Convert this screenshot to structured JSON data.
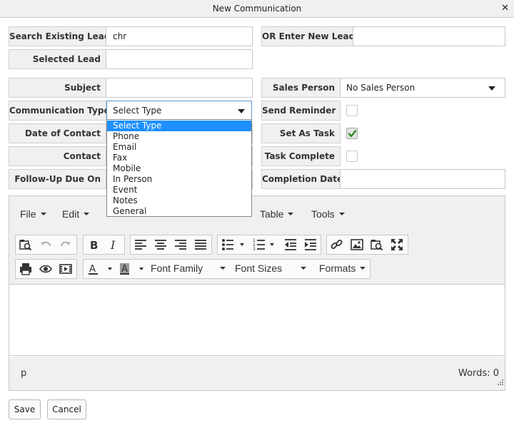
{
  "dialog": {
    "title": "New Communication"
  },
  "lead": {
    "search_label": "Search Existing Lead",
    "search_value": "chr",
    "new_label": "OR  Enter New Lead",
    "new_value": "",
    "selected_label": "Selected Lead",
    "selected_value": ""
  },
  "form": {
    "subject_label": "Subject",
    "subject_value": "",
    "comm_type_label": "Communication Type",
    "comm_type_value": "Select Type",
    "date_label": "Date of Contact",
    "contact_label": "Contact",
    "followup_label": "Follow-Up Due On",
    "sales_person_label": "Sales Person",
    "sales_person_value": "No Sales Person",
    "send_reminder_label": "Send Reminder",
    "send_reminder_checked": false,
    "set_task_label": "Set As Task",
    "set_task_checked": true,
    "task_complete_label": "Task Complete",
    "task_complete_checked": false,
    "completion_date_label": "Completion Date",
    "completion_date_value": ""
  },
  "comm_type_options": [
    "Select Type",
    "Phone",
    "Email",
    "Fax",
    "Mobile",
    "In Person",
    "Event",
    "Notes",
    "General"
  ],
  "editor": {
    "menus": [
      "File",
      "Edit",
      "Table",
      "Tools"
    ],
    "font_family_label": "Font Family",
    "font_sizes_label": "Font Sizes",
    "formats_label": "Formats",
    "status_path": "p",
    "word_count": "Words: 0"
  },
  "buttons": {
    "save": "Save",
    "cancel": "Cancel"
  },
  "colors": {
    "check_green": "#2e8b1e",
    "selection_blue": "#1e90ff",
    "focus_border": "#5b9bd5"
  }
}
